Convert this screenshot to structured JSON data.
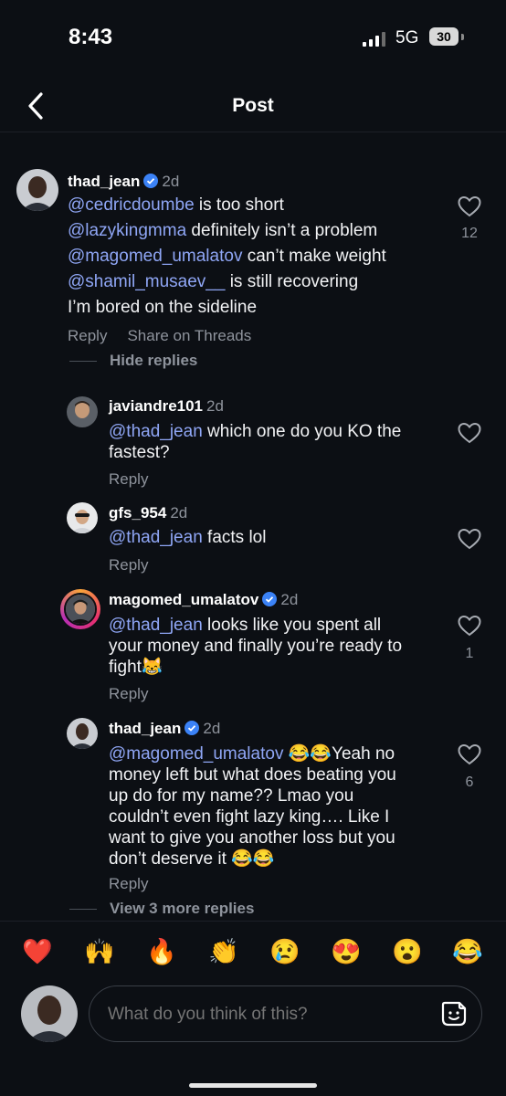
{
  "status_bar": {
    "time": "8:43",
    "network": "5G",
    "battery": "30"
  },
  "header": {
    "title": "Post"
  },
  "comment": {
    "username": "thad_jean",
    "time": "2d",
    "lines": [
      {
        "mention": "@cedricdoumbe",
        "text": " is too short"
      },
      {
        "mention": "@lazykingmma",
        "text": " definitely isn’t a problem"
      },
      {
        "mention": "@magomed_umalatov",
        "text": " can’t make weight"
      },
      {
        "mention": "@shamil_musaev__",
        "text": " is still recovering"
      },
      {
        "mention": "",
        "text": "I’m bored on the sideline"
      }
    ],
    "reply_label": "Reply",
    "share_label": "Share on Threads",
    "likes": "12",
    "hide_replies_label": "Hide replies"
  },
  "replies": [
    {
      "username": "javiandre101",
      "time": "2d",
      "verified": false,
      "mention": "@thad_jean",
      "text_line1": " which one do you KO the",
      "text_line2": "fastest?",
      "text_line3": "",
      "reply_label": "Reply",
      "likes": ""
    },
    {
      "username": "gfs_954",
      "time": "2d",
      "verified": false,
      "mention": "@thad_jean",
      "text_line1": " facts lol",
      "text_line2": "",
      "text_line3": "",
      "reply_label": "Reply",
      "likes": ""
    },
    {
      "username": "magomed_umalatov",
      "time": "2d",
      "verified": true,
      "mention": "@thad_jean",
      "text_line1": " looks like you spent all",
      "text_line2": "your money and finally you’re ready to",
      "text_line3": "fight😹",
      "reply_label": "Reply",
      "likes": "1"
    },
    {
      "username": "thad_jean",
      "time": "2d",
      "verified": true,
      "mention": "@magomed_umalatov",
      "text_line1": " 😂😂Yeah no",
      "text_line2": "money left but what does beating you",
      "text_line3": "up do for my name?? Lmao you",
      "text_line4": "couldn’t even fight lazy king…. Like I",
      "text_line5": "want to give you another loss but you",
      "text_line6": "don’t deserve it 😂😂",
      "reply_label": "Reply",
      "likes": "6"
    }
  ],
  "view_more_label": "View 3 more replies",
  "emoji_bar": [
    "❤️",
    "🙌",
    "🔥",
    "👏",
    "😢",
    "😍",
    "😮",
    "😂"
  ],
  "composer": {
    "placeholder": "What do you think of this?"
  },
  "colors": {
    "mention": "#8fa6f5",
    "verified": "#3b82f6",
    "background": "#0c0f14"
  },
  "icons": [
    "back-chevron-icon",
    "heart-icon",
    "verified-icon",
    "sticker-icon"
  ]
}
